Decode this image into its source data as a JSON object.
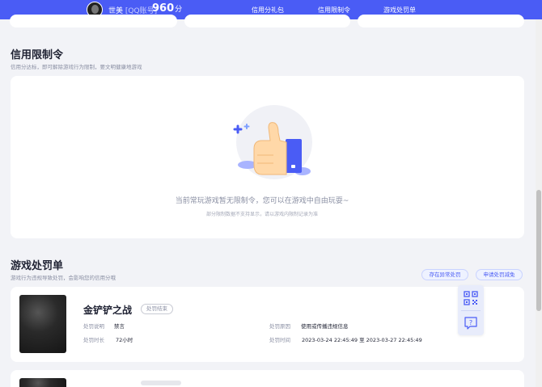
{
  "header": {
    "username": "世美",
    "account_tag": "[QQ账号]",
    "score": "960",
    "score_unit": "分",
    "nav": [
      "信用分礼包",
      "信用限制令",
      "游戏处罚单"
    ]
  },
  "restriction": {
    "title": "信用限制令",
    "desc": "信用分达标，即可解除游戏行为限制，要文明健康地游戏",
    "empty_text": "当前常玩游戏暂无限制令，您可以在游戏中自由玩耍~",
    "empty_sub": "部分限制数据不支持显示，请以游戏内限制记录为准"
  },
  "penalty": {
    "title": "游戏处罚单",
    "desc": "游戏行为违规导致处罚，会影响您的信用分哦",
    "btn_appeal": "存在异常处罚",
    "btn_reduce": "申请处罚减免",
    "items": [
      {
        "game": "金铲铲之战",
        "status": "处罚结束",
        "desc_label": "处罚说明",
        "desc_value": "禁言",
        "duration_label": "处罚时长",
        "duration_value": "72小时",
        "reason_label": "处罚原因",
        "reason_value": "使用或传播违规信息",
        "time_label": "处罚时间",
        "time_value": "2023-03-24 22:45:49 至 2023-03-27 22:45:49"
      }
    ]
  },
  "icons": {
    "qr": "qrcode-icon",
    "help": "help-icon"
  },
  "colors": {
    "brand": "#4a5cf5",
    "background": "#f2f3f7"
  }
}
